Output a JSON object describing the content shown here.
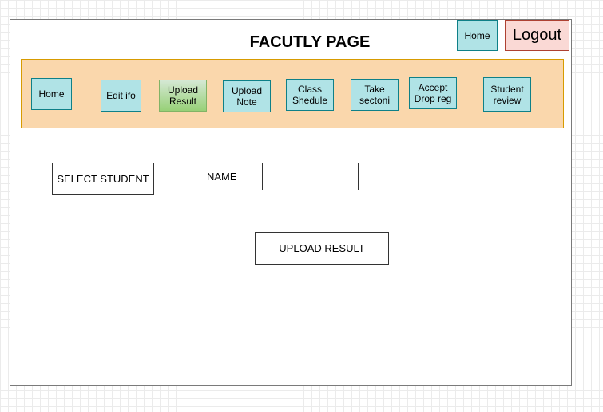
{
  "header": {
    "title": "FACUTLY PAGE",
    "home_label": "Home",
    "logout_label": "Logout"
  },
  "nav": {
    "items": [
      {
        "label": "Home"
      },
      {
        "label": "Edit ifo"
      },
      {
        "label": "Upload\nResult",
        "active": true
      },
      {
        "label": "Upload\nNote"
      },
      {
        "label": "Class\nShedule"
      },
      {
        "label": "Take\nsectoni"
      },
      {
        "label": "Accept\nDrop reg"
      },
      {
        "label": "Student\nreview"
      }
    ]
  },
  "form": {
    "select_student_label": "SELECT STUDENT",
    "name_label": "NAME",
    "name_value": "",
    "upload_button_label": "UPLOAD RESULT"
  },
  "colors": {
    "nav_bar_fill": "#fad7ac",
    "nav_button_fill": "#b0e3e6",
    "active_button_fill": "#97d077",
    "logout_fill": "#fad9d5"
  }
}
